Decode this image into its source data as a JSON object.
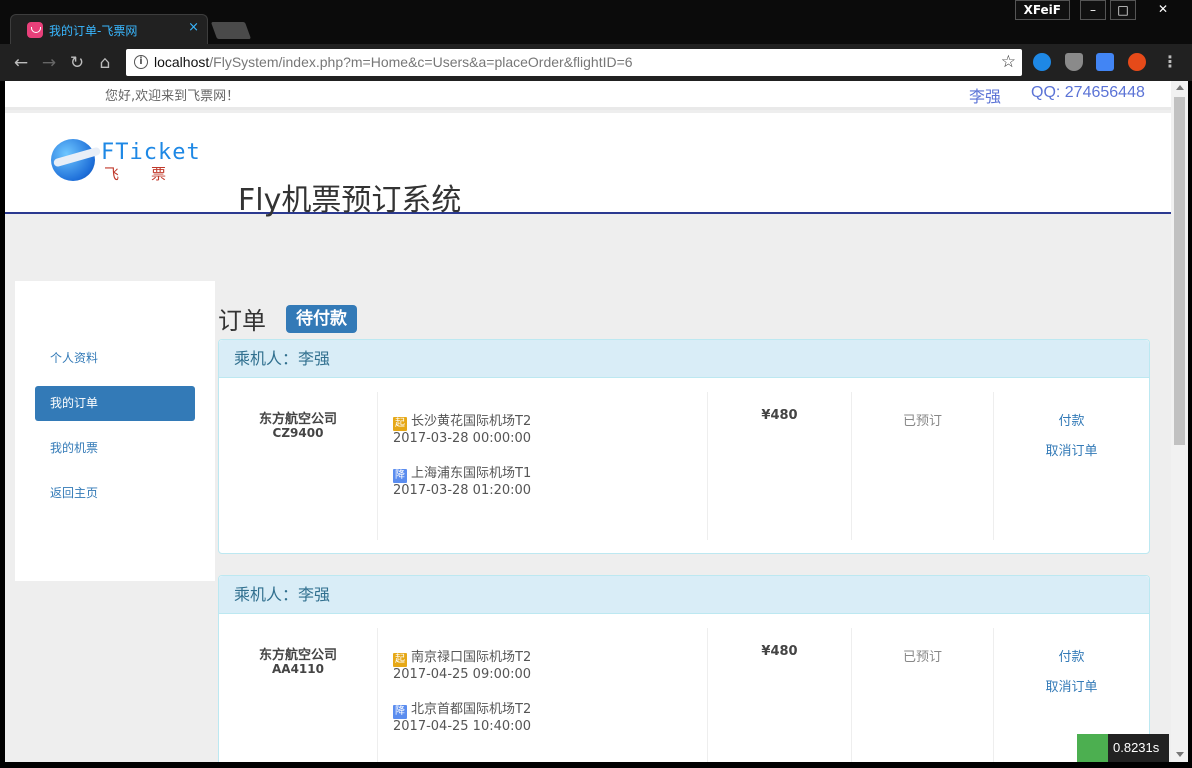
{
  "browser": {
    "tab_title": "我的订单-飞票网",
    "tab_close": "×",
    "extension_label": "XFeiF",
    "win_min": "–",
    "win_max": "□",
    "win_close": "✕",
    "url_host": "localhost",
    "url_rest": "/FlySystem/index.php?m=Home&c=Users&a=placeOrder&flightID=6",
    "back": "←",
    "forward": "→",
    "reload": "↻",
    "home": "⌂",
    "star": "☆",
    "info": "i",
    "menu": "⋮"
  },
  "topbar": {
    "welcome": "您好,欢迎来到飞票网！",
    "user": "李强",
    "qq": "QQ: 274656448"
  },
  "header": {
    "logo_text": "FTicket",
    "logo_sub": "飞票",
    "site_title": "Fly机票预订系统"
  },
  "sidebar": {
    "items": [
      {
        "label": "个人资料"
      },
      {
        "label": "我的订单"
      },
      {
        "label": "我的机票"
      },
      {
        "label": "返回主页"
      }
    ]
  },
  "main": {
    "heading": "订单",
    "badge": "待付款",
    "orders": [
      {
        "passenger": "乘机人：李强",
        "airline": "东方航空公司",
        "flight": "CZ9400",
        "dep_tag": "起",
        "dep_airport": "长沙黄花国际机场T2",
        "dep_time": "2017-03-28 00:00:00",
        "arr_tag": "降",
        "arr_airport": "上海浦东国际机场T1",
        "arr_time": "2017-03-28 01:20:00",
        "price": "¥480",
        "status": "已预订",
        "pay": "付款",
        "cancel": "取消订单"
      },
      {
        "passenger": "乘机人：李强",
        "airline": "东方航空公司",
        "flight": "AA4110",
        "dep_tag": "起",
        "dep_airport": "南京禄口国际机场T2",
        "dep_time": "2017-04-25 09:00:00",
        "arr_tag": "降",
        "arr_airport": "北京首都国际机场T2",
        "arr_time": "2017-04-25 10:40:00",
        "price": "¥480",
        "status": "已预订",
        "pay": "付款",
        "cancel": "取消订单"
      }
    ]
  },
  "timer": {
    "value": "0.8231s"
  }
}
